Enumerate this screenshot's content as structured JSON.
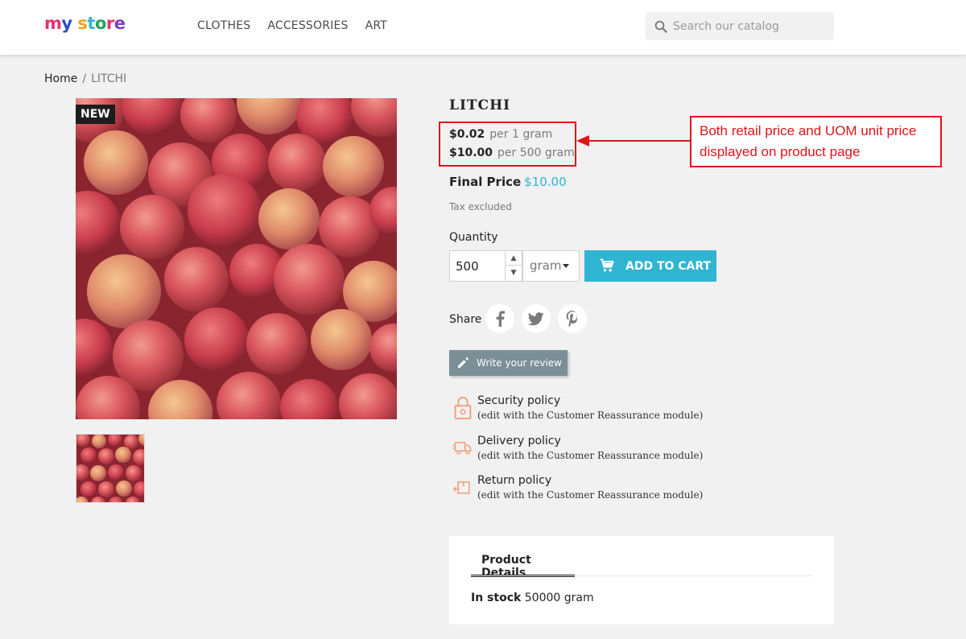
{
  "header": {
    "logo": "my store",
    "nav": [
      "CLOTHES",
      "ACCESSORIES",
      "ART"
    ],
    "search_placeholder": "Search our catalog"
  },
  "breadcrumb": {
    "home": "Home",
    "separator": "/",
    "current": "LITCHI"
  },
  "gallery": {
    "badge": "NEW"
  },
  "product": {
    "title": "LITCHI",
    "unit_price": "$0.02",
    "unit_price_label": "per 1 gram",
    "retail_price": "$10.00",
    "retail_price_label": "per 500 gram",
    "final_price_label": "Final Price",
    "final_price_value": "$10.00",
    "tax_note": "Tax excluded",
    "quantity_label": "Quantity",
    "quantity_value": "500",
    "uom": "gram",
    "add_to_cart": "ADD TO CART",
    "share_label": "Share",
    "write_review": "Write your review"
  },
  "annotation": {
    "text": "Both retail price and UOM unit price displayed on product page"
  },
  "reassurance": [
    {
      "title": "Security policy",
      "subtitle": "(edit with the Customer Reassurance module)",
      "icon": "lock-icon"
    },
    {
      "title": "Delivery policy",
      "subtitle": "(edit with the Customer Reassurance module)",
      "icon": "truck-icon"
    },
    {
      "title": "Return policy",
      "subtitle": "(edit with the Customer Reassurance module)",
      "icon": "return-box-icon"
    }
  ],
  "details": {
    "tab_label": "Product Details",
    "stock_label": "In stock",
    "stock_value": "50000 gram"
  },
  "colors": {
    "accent": "#2fb5d2",
    "annotation": "#e0141a",
    "review_button": "#7a8f96"
  }
}
